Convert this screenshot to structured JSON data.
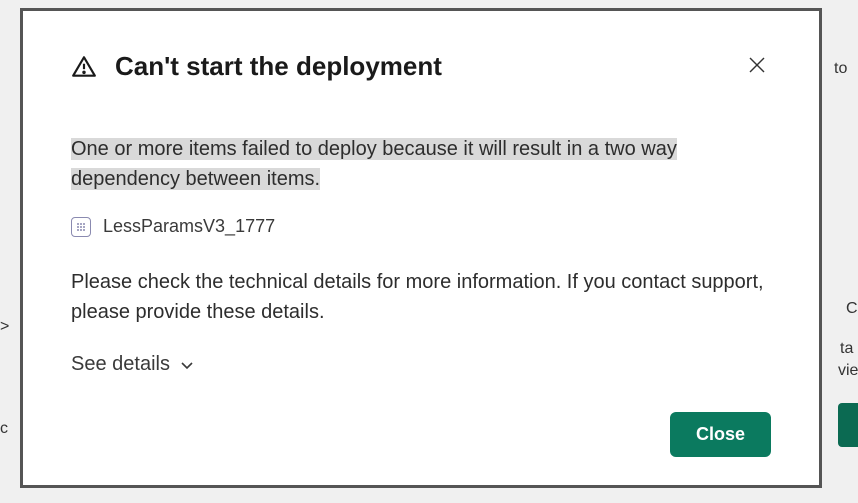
{
  "modal": {
    "title": "Can't start the deployment",
    "error_message_line1": "One or more items failed to deploy because it will result in a two way",
    "error_message_line2": "dependency between items.",
    "item_name": "LessParamsV3_1777",
    "instruction": "Please check the technical details for more information. If you contact support, please provide these details.",
    "details_toggle_label": "See details",
    "close_button_label": "Close"
  },
  "background": {
    "frag1": "to",
    "frag2": "C",
    "frag3": "ta",
    "frag4": "vie",
    "frag5": ">",
    "frag6": "c"
  }
}
